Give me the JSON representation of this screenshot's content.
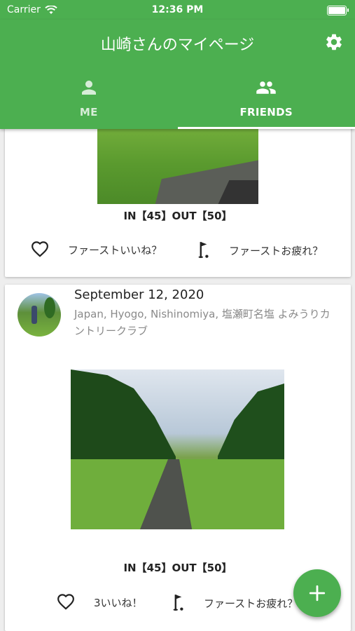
{
  "status": {
    "carrier": "Carrier",
    "time": "12:36 PM"
  },
  "appbar": {
    "title": "山崎さんのマイページ"
  },
  "tabs": [
    {
      "label": "ME"
    },
    {
      "label": "FRIENDS"
    }
  ],
  "posts": [
    {
      "score": "IN【45】OUT【50】",
      "like_label": "ファーストいいね？",
      "cheer_label": "ファーストお疲れ？"
    },
    {
      "date": "September 12, 2020",
      "location": "Japan, Hyogo, Nishinomiya, 塩瀬町名塩 よみうりカントリークラブ",
      "score": "IN【45】OUT【50】",
      "like_label": "3いいね！",
      "cheer_label": "ファーストお疲れ？"
    }
  ],
  "colors": {
    "primary": "#4caf50"
  },
  "icons": [
    "wifi-icon",
    "battery-icon",
    "settings-gear-icon",
    "person-icon",
    "group-icon",
    "heart-icon",
    "golf-flag-icon",
    "plus-icon"
  ]
}
